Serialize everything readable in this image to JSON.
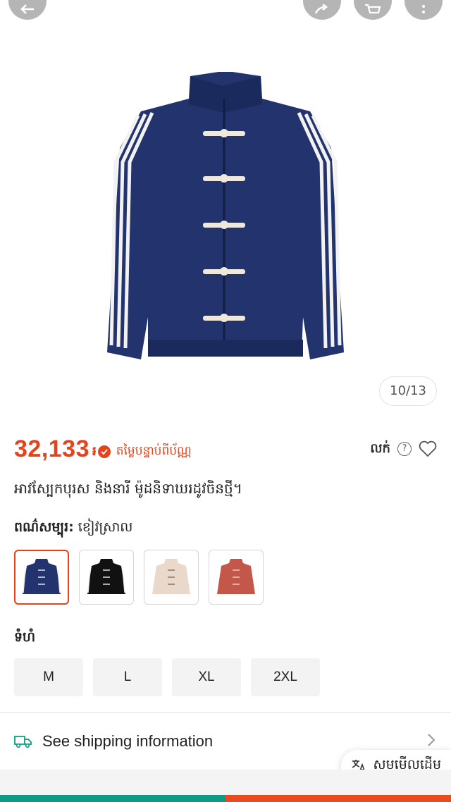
{
  "gallery": {
    "counter": "10/13"
  },
  "price": {
    "amount": "32,133",
    "currency": "៛",
    "note": "តម្លៃបន្ទាប់ពីប័ណ្ណ"
  },
  "actions": {
    "sell_label": "លក់",
    "help_glyph": "?"
  },
  "product": {
    "title": "អាវស្បែកបុរស និងនារី ម៉ូដនិទាឃរដូវចិនថ្មី។"
  },
  "color": {
    "label": "ពណ៌សម្បុរ:",
    "selected": "ខៀវស្រាល",
    "options": [
      {
        "color": "#23336e"
      },
      {
        "color": "#111111"
      },
      {
        "color": "#ead8cb"
      },
      {
        "color": "#c2574a"
      }
    ]
  },
  "size": {
    "label": "ទំហំ",
    "options": [
      "M",
      "L",
      "XL",
      "2XL"
    ]
  },
  "shipping": {
    "label": "See shipping information"
  },
  "translate": {
    "label": "សូមមើលដើម"
  },
  "colors": {
    "accent": "#e4431c",
    "teal": "#0e9a86",
    "orange": "#ea4a1d"
  }
}
